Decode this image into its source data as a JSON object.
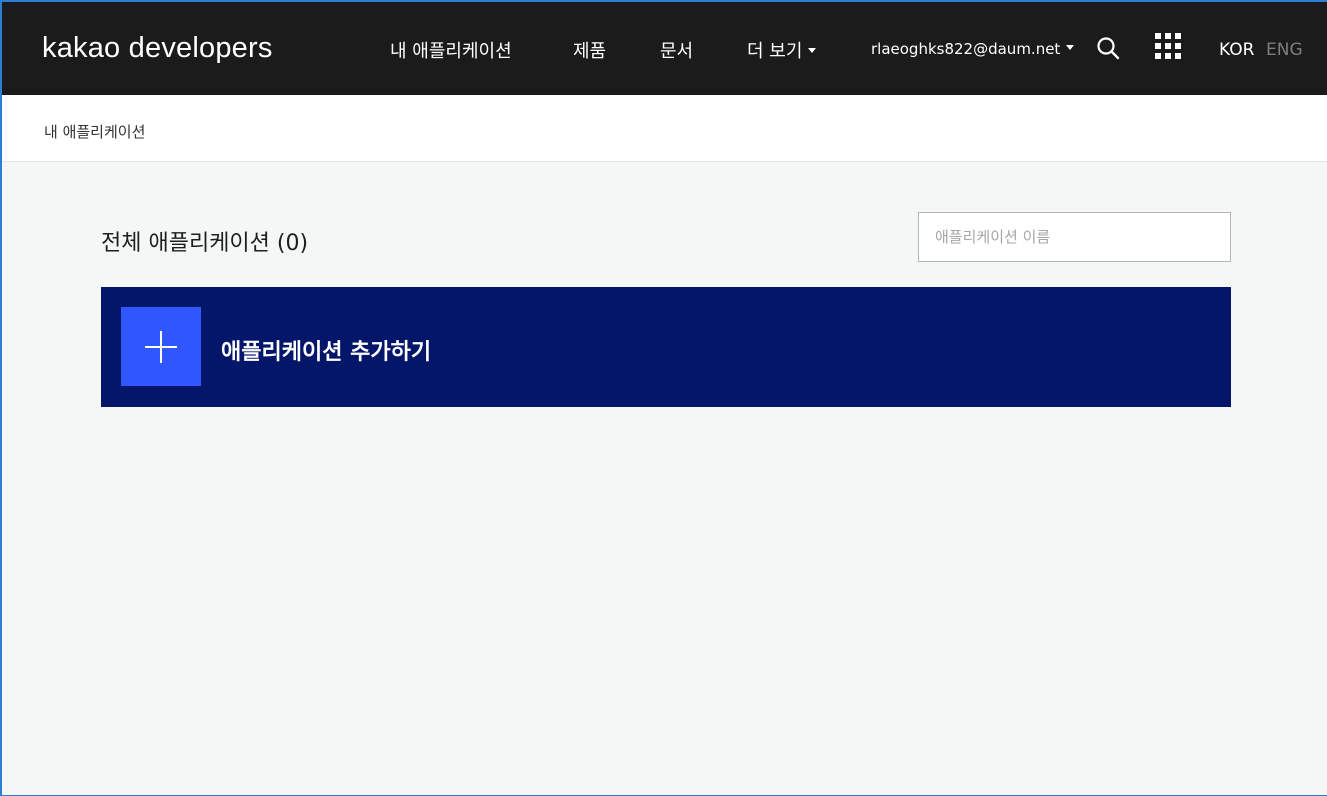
{
  "header": {
    "logo": {
      "brand": "kakao",
      "product": "developers"
    },
    "nav": {
      "my_apps": "내 애플리케이션",
      "products": "제품",
      "docs": "문서",
      "more": "더 보기"
    },
    "account": "rlaeoghks822@daum.net",
    "lang": {
      "kor": "KOR",
      "eng": "ENG"
    }
  },
  "breadcrumb": {
    "current": "내 애플리케이션"
  },
  "main": {
    "title": "전체 애플리케이션 (0)",
    "search": {
      "placeholder": "애플리케이션 이름",
      "value": ""
    },
    "add_app_label": "애플리케이션 추가하기"
  },
  "colors": {
    "header_bg": "#1b1b1b",
    "page_bg": "#f5f7f7",
    "card_bg": "#03166a",
    "accent": "#3056ff",
    "inactive_lang": "#7d7d7d"
  },
  "icons": {
    "search": "search-icon",
    "apps": "apps-grid-icon",
    "add": "plus-icon",
    "dropdown": "caret-down-icon"
  }
}
